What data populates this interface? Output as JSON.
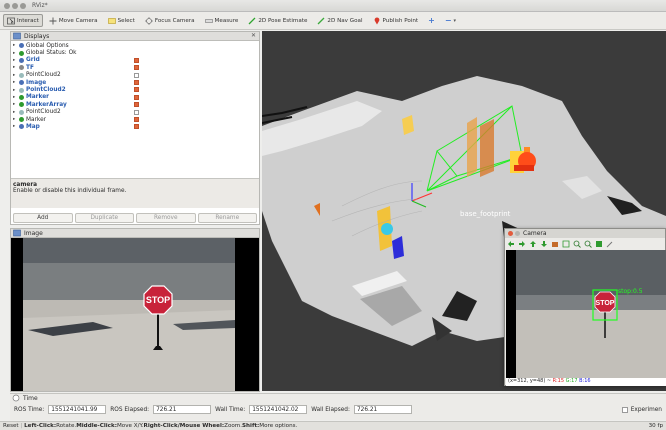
{
  "window": {
    "title": "RViz*"
  },
  "toolbar": {
    "interact": "Interact",
    "move_camera": "Move Camera",
    "select": "Select",
    "focus_camera": "Focus Camera",
    "measure": "Measure",
    "pose_estimate": "2D Pose Estimate",
    "nav_goal": "2D Nav Goal",
    "publish_point": "Publish Point",
    "plus": "+",
    "minus": "−",
    "dropdown": "▾"
  },
  "displays": {
    "title": "Displays",
    "items": [
      {
        "label": "Global Options",
        "checked": null,
        "blue": false,
        "icon_color": "#4a6fb5"
      },
      {
        "label": "Global Status: Ok",
        "checked": null,
        "blue": false,
        "icon_color": "#2e9a2e"
      },
      {
        "label": "Grid",
        "checked": true,
        "blue": true,
        "icon_color": "#4a6fb5"
      },
      {
        "label": "TF",
        "checked": true,
        "blue": true,
        "icon_color": "#888"
      },
      {
        "label": "PointCloud2",
        "checked": false,
        "blue": false,
        "icon_color": "#9bb"
      },
      {
        "label": "Image",
        "checked": true,
        "blue": true,
        "icon_color": "#4a6fb5"
      },
      {
        "label": "PointCloud2",
        "checked": true,
        "blue": true,
        "icon_color": "#9bb"
      },
      {
        "label": "Marker",
        "checked": true,
        "blue": true,
        "icon_color": "#2e9a2e"
      },
      {
        "label": "MarkerArray",
        "checked": true,
        "blue": true,
        "icon_color": "#2e9a2e"
      },
      {
        "label": "PointCloud2",
        "checked": false,
        "blue": false,
        "icon_color": "#9bb"
      },
      {
        "label": "Marker",
        "checked": true,
        "blue": false,
        "icon_color": "#2e9a2e"
      },
      {
        "label": "Map",
        "checked": true,
        "blue": true,
        "icon_color": "#4a6fb5"
      }
    ],
    "desc_title": "camera",
    "desc_text": "Enable or disable this individual frame.",
    "add": "Add",
    "duplicate": "Duplicate",
    "remove": "Remove",
    "rename": "Rename"
  },
  "image_panel": {
    "title": "Image",
    "sign_text": "STOP"
  },
  "viewport": {
    "frame_label": "base_footprint"
  },
  "camera_window": {
    "title": "Camera",
    "detection_label": "stop:0.5",
    "sign_text": "STOP",
    "status_coords": "(x=312, y=48) ~ ",
    "status_r": "R:15",
    "status_g": "G:17",
    "status_b": "B:16"
  },
  "time": {
    "title": "Time",
    "ros_time_label": "ROS Time:",
    "ros_time": "1551241041.99",
    "ros_elapsed_label": "ROS Elapsed:",
    "ros_elapsed": "726.21",
    "wall_time_label": "Wall Time:",
    "wall_time": "1551241042.02",
    "wall_elapsed_label": "Wall Elapsed:",
    "wall_elapsed": "726.21",
    "experimental": "Experimen"
  },
  "status": {
    "reset": "Reset",
    "left_click": "Left-Click:",
    "left_action": " Rotate. ",
    "middle_click": "Middle-Click:",
    "middle_action": " Move X/Y. ",
    "right_click": "Right-Click/Mouse Wheel:",
    "right_action": " Zoom. ",
    "shift": "Shift:",
    "shift_action": " More options.",
    "fps": "30 fp"
  }
}
